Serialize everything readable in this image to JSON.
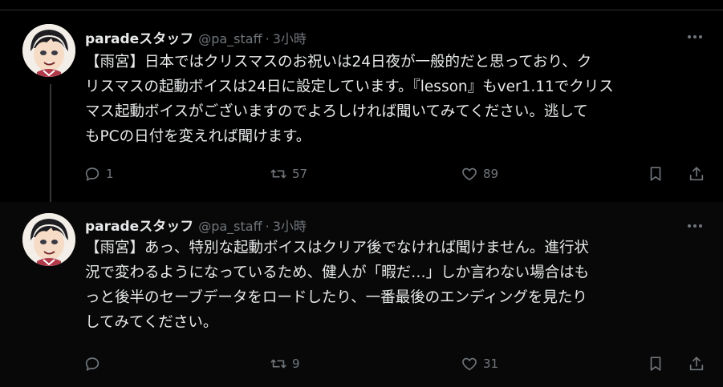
{
  "tweets": [
    {
      "name": "paradeスタッフ",
      "handle": "@pa_staff",
      "separator": "·",
      "time": "3小時",
      "text": "【雨宮】日本ではクリスマスのお祝いは24日夜が一般的だと思っており、ク\nリスマスの起動ボイスは24日に設定しています。『lesson』もver1.11でクリス\nマス起動ボイスがございますのでよろしければ聞いてみてください。逃して\nもPCの日付を変えれば聞けます。",
      "replies": "1",
      "retweets": "57",
      "likes": "89"
    },
    {
      "name": "paradeスタッフ",
      "handle": "@pa_staff",
      "separator": "·",
      "time": "3小時",
      "text": "【雨宮】あっ、特別な起動ボイスはクリア後でなければ聞けません。進行状\n況で変わるようになっているため、健人が「暇だ…」しか言わない場合はも\nっと後半のセーブデータをロードしたり、一番最後のエンディングを見たり\nしてみてください。",
      "replies": "",
      "retweets": "9",
      "likes": "31"
    }
  ],
  "icons": {
    "more": "more-horizontal-icon",
    "reply": "reply-icon",
    "retweet": "retweet-icon",
    "like": "heart-icon",
    "bookmark": "bookmark-icon",
    "share": "share-icon"
  },
  "colors": {
    "background": "#000000",
    "text": "#e7e9ea",
    "secondary": "#71767b",
    "divider": "#2f3336"
  }
}
